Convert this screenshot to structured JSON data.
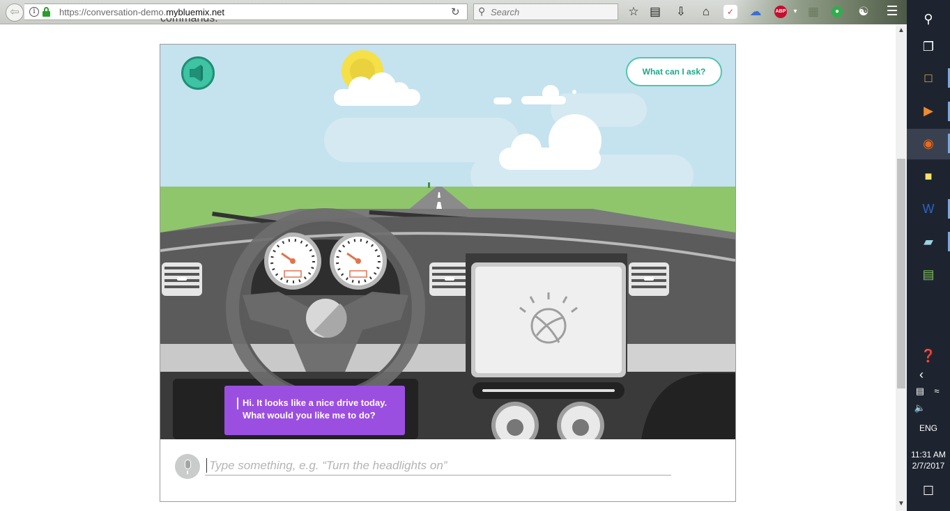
{
  "browser": {
    "url_prefix": "https://conversation-demo.",
    "url_domain": "mybluemix.net",
    "search_placeholder": "Search",
    "icons": [
      "back-icon",
      "info-icon",
      "lock-icon",
      "reload-icon",
      "search-icon",
      "bookmark-star-icon",
      "reading-list-icon",
      "download-icon",
      "home-icon",
      "pocket-icon",
      "weather-icon",
      "adblock-icon",
      "extension-icon",
      "green-extension-icon",
      "globe-icon",
      "menu-icon"
    ],
    "adblock_label": "ABP"
  },
  "page": {
    "cut_off_text": "commands."
  },
  "demo": {
    "ask_button_label": "What can I ask?",
    "chat_message_line1": "Hi. It looks like a nice drive today.",
    "chat_message_line2": "What would you like me to do?",
    "input_placeholder": "Type something, e.g. “Turn the headlights on”",
    "colors": {
      "sky": "#c5e2ef",
      "grass": "#8fc66c",
      "dashboard": "#555555",
      "accent_teal": "#3ec3a3",
      "bubble_purple": "#9b4fe0"
    }
  },
  "taskbar": {
    "language": "ENG",
    "time": "11:31 AM",
    "date": "2/7/2017",
    "icons": [
      "search-icon",
      "task-view-icon",
      "file-explorer-icon",
      "media-player-icon",
      "firefox-icon",
      "sticky-notes-icon",
      "word-icon",
      "eraser-app-icon",
      "chart-app-icon",
      "help-icon",
      "chevron-left-icon",
      "battery-icon",
      "wifi-icon",
      "volume-icon",
      "action-center-icon"
    ]
  }
}
